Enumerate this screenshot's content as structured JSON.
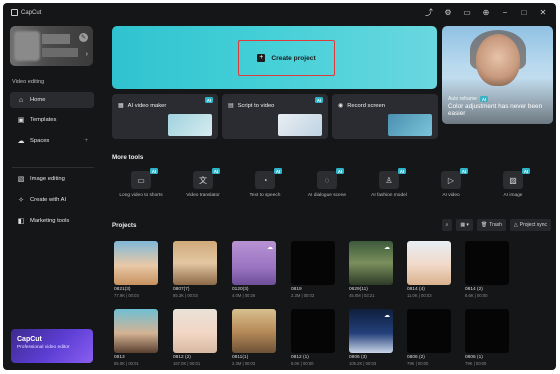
{
  "app": {
    "title": "CapCut"
  },
  "window_controls": [
    {
      "name": "share-icon",
      "glyph": "⤴"
    },
    {
      "name": "settings-icon",
      "glyph": "⚙"
    },
    {
      "name": "feedback-icon",
      "glyph": "▭"
    },
    {
      "name": "add-icon",
      "glyph": "⊕"
    },
    {
      "name": "minimize-icon",
      "glyph": "−"
    },
    {
      "name": "maximize-icon",
      "glyph": "□"
    },
    {
      "name": "close-icon",
      "glyph": "✕"
    }
  ],
  "sidebar": {
    "section_label": "Video editing",
    "nav": [
      {
        "label": "Home",
        "icon": "home-icon",
        "glyph": "⌂"
      },
      {
        "label": "Templates",
        "icon": "templates-icon",
        "glyph": "▣"
      },
      {
        "label": "Spaces",
        "icon": "cloud-icon",
        "glyph": "☁",
        "caret": "+"
      }
    ],
    "tools": [
      {
        "label": "Image editing",
        "icon": "image-edit-icon",
        "glyph": "▧"
      },
      {
        "label": "Create with AI",
        "icon": "ai-create-icon",
        "glyph": "✧"
      },
      {
        "label": "Marketing tools",
        "icon": "marketing-icon",
        "glyph": "◧"
      }
    ],
    "promo": {
      "title": "CapCut",
      "subtitle": "Professional video editor"
    }
  },
  "hero": {
    "create_label": "Create project"
  },
  "ad": {
    "tag": "Auto reframe",
    "badge": "AI",
    "text": "Color adjustment has never been easier"
  },
  "quick_cards": [
    {
      "label": "AI video maker",
      "icon": "ai-video-maker-icon",
      "glyph": "▦",
      "badge": "AI"
    },
    {
      "label": "Script to video",
      "icon": "script-icon",
      "glyph": "▤",
      "badge": "AI"
    },
    {
      "label": "Record screen",
      "icon": "record-icon",
      "glyph": "◉",
      "badge": ""
    }
  ],
  "more_tools": {
    "title": "More tools",
    "items": [
      {
        "label": "Long video to shorts",
        "icon": "long-video-icon",
        "glyph": "▭",
        "badge": "AI"
      },
      {
        "label": "Video translator",
        "icon": "translate-icon",
        "glyph": "文",
        "badge": "AI"
      },
      {
        "label": "Text to speech",
        "icon": "tts-icon",
        "glyph": "◔",
        "badge": "AI"
      },
      {
        "label": "AI dialogue scene",
        "icon": "dialogue-icon",
        "glyph": "◌",
        "badge": "AI"
      },
      {
        "label": "AI fashion model",
        "icon": "fashion-icon",
        "glyph": "♙",
        "badge": "AI"
      },
      {
        "label": "AI video",
        "icon": "ai-video-icon",
        "glyph": "▷",
        "badge": "AI"
      },
      {
        "label": "AI image",
        "icon": "ai-image-icon",
        "glyph": "▨",
        "badge": "AI"
      }
    ]
  },
  "projects": {
    "title": "Projects",
    "toolbar": {
      "search_icon": "search-icon",
      "view": "▦ ▾",
      "trash": "Trash",
      "sync": "Project sync"
    },
    "items": [
      {
        "name": "0821(3)",
        "meta": "77.9K | 00:03",
        "thumb": "linear-gradient(180deg,#7fb8d8 0%,#e8c9a8 55%,#c7915f 100%)",
        "cloud": false
      },
      {
        "name": "0807(7)",
        "meta": "65.3K | 00:03",
        "thumb": "linear-gradient(180deg,#cfa97a 0%,#e3c7a2 50%,#8c6a47 100%)",
        "cloud": false
      },
      {
        "name": "0120(3)",
        "meta": "4.0M | 00:26",
        "thumb": "linear-gradient(180deg,#b893d3 0%,#9b74c2 60%,#6d4e98 100%)",
        "cloud": true
      },
      {
        "name": "0819",
        "meta": "2.3M | 00:03",
        "thumb": "#050505",
        "cloud": false
      },
      {
        "name": "0629(11)",
        "meta": "45.0M | 03:21",
        "thumb": "linear-gradient(180deg,#3d5a3a 0%,#7a8f5c 50%,#2d3b28 100%)",
        "cloud": true
      },
      {
        "name": "0814 (4)",
        "meta": "11.0K | 00:03",
        "thumb": "linear-gradient(180deg,#e7eef4 0%,#f1d9c8 55%,#d9b08c 100%)",
        "cloud": false
      },
      {
        "name": "0814 (2)",
        "meta": "8.6K | 00:00",
        "thumb": "#050505",
        "cloud": false
      },
      {
        "name": "0813",
        "meta": "55.0K | 00:01",
        "thumb": "linear-gradient(180deg,#6fbfd3 0%,#d4b394 55%,#5a4030 100%)",
        "cloud": false
      },
      {
        "name": "0812 (2)",
        "meta": "167.0K | 00:01",
        "thumb": "linear-gradient(180deg,#e9e2d8 0%,#f2d6c4 55%,#d7b9a2 100%)",
        "cloud": false
      },
      {
        "name": "0811(1)",
        "meta": "2.3M | 00:03",
        "thumb": "linear-gradient(180deg,#d7c08e 0%,#b88b5a 50%,#6d5236 100%)",
        "cloud": false
      },
      {
        "name": "0812 (1)",
        "meta": "8.0K | 00:00",
        "thumb": "#050505",
        "cloud": false
      },
      {
        "name": "0806 (3)",
        "meta": "105.2K | 00:03",
        "thumb": "linear-gradient(180deg,#0f1f3d 0%,#23407a 55%,#c9d6e8 100%)",
        "cloud": true
      },
      {
        "name": "0806 (2)",
        "meta": "79K | 00:00",
        "thumb": "#050505",
        "cloud": false
      },
      {
        "name": "0806 (1)",
        "meta": "79K | 00:00",
        "thumb": "#050505",
        "cloud": false
      }
    ]
  }
}
